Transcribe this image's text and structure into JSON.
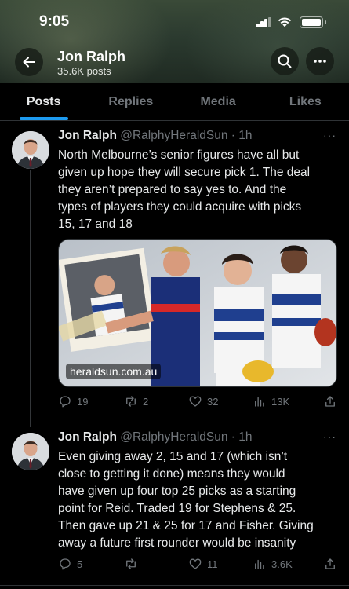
{
  "status_bar": {
    "time": "9:05"
  },
  "header": {
    "name": "Jon Ralph",
    "post_count": "35.6K posts",
    "back_icon": "arrow-left-icon",
    "search_icon": "search-icon",
    "more_icon": "more-horizontal-icon"
  },
  "tabs": [
    {
      "label": "Posts",
      "active": true
    },
    {
      "label": "Replies",
      "active": false
    },
    {
      "label": "Media",
      "active": false
    },
    {
      "label": "Likes",
      "active": false
    }
  ],
  "colors": {
    "accent": "#1d9bf0",
    "background": "#000000",
    "muted": "#71767b",
    "text": "#e7e9ea"
  },
  "tweets": [
    {
      "name": "Jon Ralph",
      "handle": "@RalphyHeraldSun",
      "time": "· 1h",
      "more": "···",
      "text": "North Melbourne’s senior figures have all but\ngiven up hope they will secure pick 1. The deal\nthey aren’t prepared to say yes to. And the\ntypes of players they could acquire with picks\n15, 17 and 18",
      "media_watermark": "heraldsun.com.au",
      "replies": "19",
      "reposts": "2",
      "likes": "32",
      "views": "13K"
    },
    {
      "name": "Jon Ralph",
      "handle": "@RalphyHeraldSun",
      "time": "· 1h",
      "more": "···",
      "text": "Even giving away 2, 15 and 17 (which isn’t\nclose to getting it done) means they would\nhave given up four top 25 picks as a starting\npoint for Reid. Traded 19 for Stephens & 25.\nThen gave up 21 & 25 for 17 and Fisher. Giving\naway a future first rounder would be insanity",
      "replies": "5",
      "reposts": "",
      "likes": "11",
      "views": "3.6K"
    }
  ]
}
